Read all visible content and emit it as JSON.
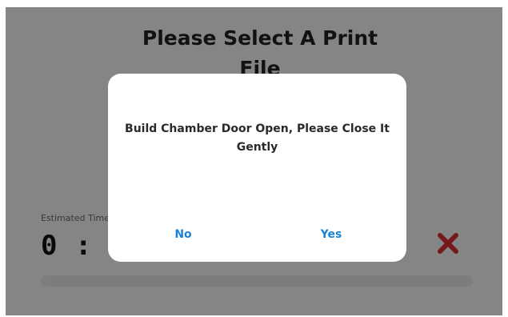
{
  "page": {
    "title": "Please Select A Print File"
  },
  "print_info": {
    "estimated_time_label": "Estimated Time",
    "estimated_time_value": "0 : 00"
  },
  "icons": {
    "cancel": "close-icon"
  },
  "dialog": {
    "message": "Build Chamber Door Open, Please Close It Gently",
    "no_label": "No",
    "yes_label": "Yes"
  },
  "colors": {
    "accent": "#1a82d6",
    "cancel": "#d32f2f",
    "overlay": "rgba(0,0,0,0.45)"
  }
}
